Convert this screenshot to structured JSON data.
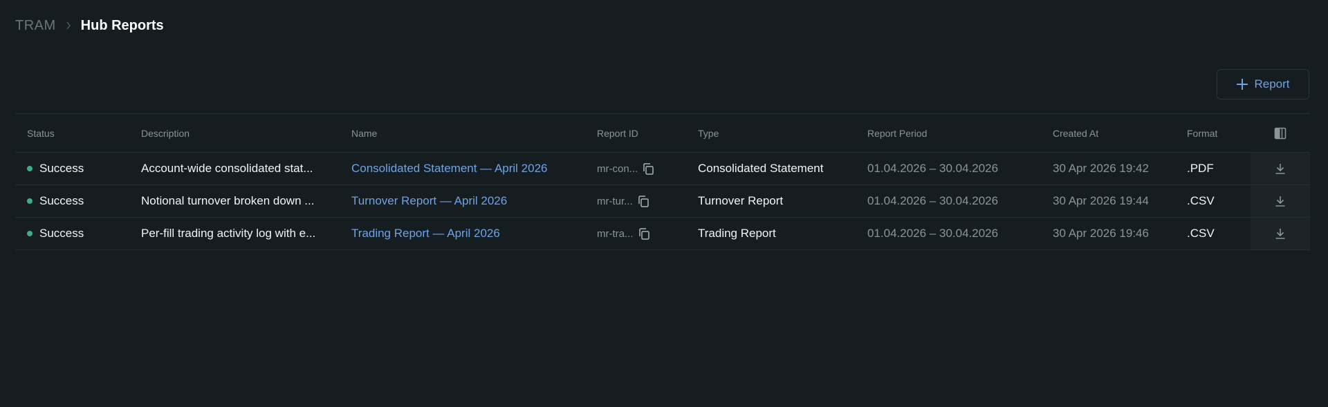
{
  "breadcrumb": {
    "root": "TRAM",
    "current": "Hub Reports"
  },
  "toolbar": {
    "add_report_label": "Report",
    "add_icon": "plus-icon"
  },
  "table": {
    "headers": {
      "status": "Status",
      "description": "Description",
      "name": "Name",
      "report_id": "Report ID",
      "type": "Type",
      "report_period": "Report Period",
      "created_at": "Created At",
      "format": "Format"
    },
    "columns_icon": "columns-icon",
    "rows": [
      {
        "status": "Success",
        "description": "Account-wide consolidated stat...",
        "name": "Consolidated Statement — April 2026",
        "report_id": "mr-con...",
        "type": "Consolidated Statement",
        "report_period": "01.04.2026 – 30.04.2026",
        "created_at": "30 Apr 2026 19:42",
        "format": ".PDF"
      },
      {
        "status": "Success",
        "description": "Notional turnover broken down ...",
        "name": "Turnover Report — April 2026",
        "report_id": "mr-tur...",
        "type": "Turnover Report",
        "report_period": "01.04.2026 – 30.04.2026",
        "created_at": "30 Apr 2026 19:44",
        "format": ".CSV"
      },
      {
        "status": "Success",
        "description": "Per-fill trading activity log with e...",
        "name": "Trading Report — April 2026",
        "report_id": "mr-tra...",
        "type": "Trading Report",
        "report_period": "01.04.2026 – 30.04.2026",
        "created_at": "30 Apr 2026 19:46",
        "format": ".CSV"
      }
    ]
  },
  "colors": {
    "background": "#161d20",
    "accent_link": "#6ea3e6",
    "status_success": "#3fae87",
    "border": "#263134"
  }
}
